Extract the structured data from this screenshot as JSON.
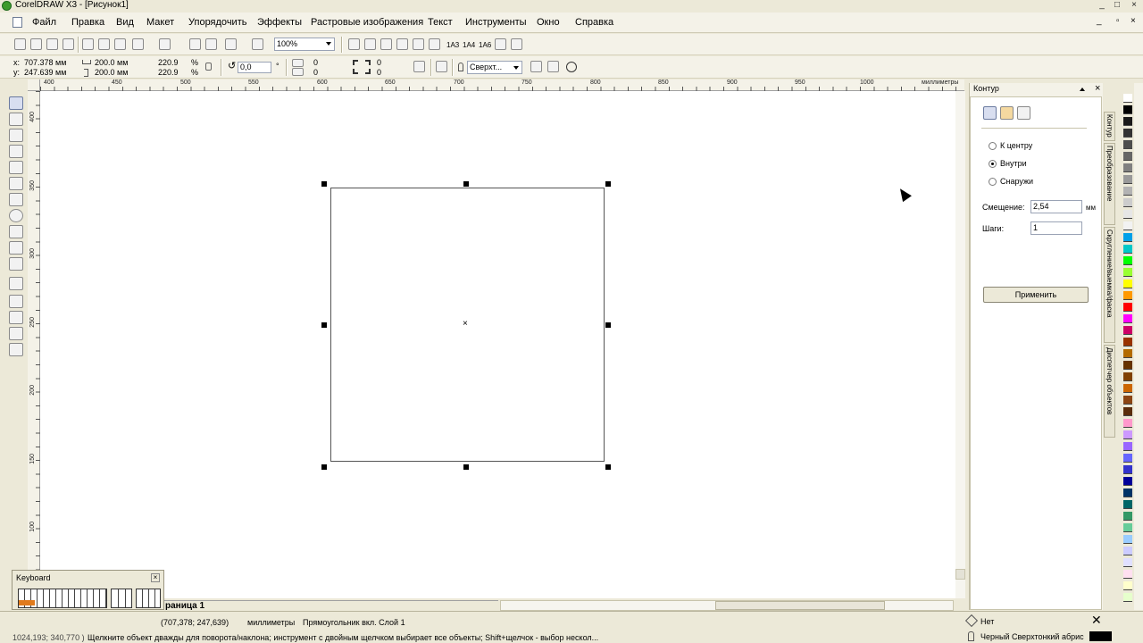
{
  "window": {
    "title": "CorelDRAW X3 - [Рисунок1]",
    "controls": [
      "_",
      "□",
      "×"
    ],
    "doc_controls": [
      "_",
      "▫",
      "×"
    ]
  },
  "menu": [
    "Файл",
    "Правка",
    "Вид",
    "Макет",
    "Упорядочить",
    "Эффекты",
    "Растровые изображения",
    "Текст",
    "Инструменты",
    "Окно",
    "Справка"
  ],
  "toolbar": {
    "zoom": "100%",
    "text_icons": [
      "1A3",
      "1A4",
      "1A6"
    ]
  },
  "propbar": {
    "x_label": "x:",
    "x_value": "707.378 мм",
    "y_label": "y:",
    "y_value": "247.639 мм",
    "width": "200.0 мм",
    "height": "200.0 мм",
    "scale_w": "220.9",
    "scale_h": "220.9",
    "pct": "%",
    "angle": "0,0",
    "deg": "°",
    "corner_tl": "0",
    "corner_bl": "0",
    "corner_tr": "0",
    "corner_br": "0",
    "outline_width": "Сверхт..."
  },
  "ruler_top": {
    "ticks": [
      "400",
      "450",
      "500",
      "550",
      "600",
      "650",
      "700",
      "750",
      "800",
      "850",
      "900",
      "950",
      "1000"
    ],
    "units": "миллиметры"
  },
  "ruler_left": {
    "ticks": [
      "400",
      "350",
      "300",
      "250",
      "200",
      "150",
      "100"
    ]
  },
  "docker": {
    "title": "Контур",
    "options": [
      "К центру",
      "Внутри",
      "Снаружи"
    ],
    "selected_option": "Внутри",
    "offset_label": "Смещение:",
    "offset_value": "2,54",
    "offset_unit": "мм",
    "steps_label": "Шаги:",
    "steps_value": "1",
    "apply_label": "Применить"
  },
  "vertical_tabs": [
    "Контур",
    "Преобразование",
    "Скругление/выемка/фаска",
    "Диспетчер объектов"
  ],
  "page_tab": "раница 1",
  "keyboard_widget": {
    "title": "Keyboard"
  },
  "status": {
    "coords": "(707,378; 247,639)",
    "units": "миллиметры",
    "object_info": "Прямоугольник вкл. Слой 1",
    "hint_prefix": "1024,193; 340,770 )",
    "hint": "Щелкните объект дважды для поворота/наклона; инструмент с двойным щелчком выбирает все объекты; Shift+щелчок - выбор нескол...",
    "fill_label": "Нет",
    "outline_label": "Черный  Сверхтонкий абрис"
  },
  "colors": {
    "palette": [
      "#ffffff",
      "#000000",
      "#1a1a1a",
      "#333333",
      "#4d4d4d",
      "#666666",
      "#808080",
      "#999999",
      "#b3b3b3",
      "#cccccc",
      "#e6e6e6",
      "#f2f2f2",
      "#00a0e8",
      "#00c8c8",
      "#00ff00",
      "#99ff33",
      "#ffff00",
      "#ff9900",
      "#ff0000",
      "#ff00ff",
      "#cc0066",
      "#993300",
      "#b36b00",
      "#663300",
      "#804000",
      "#cc6600",
      "#8b4513",
      "#5a2d0c",
      "#ff99cc",
      "#cc99ff",
      "#9966ff",
      "#6666ff",
      "#3333cc",
      "#000099",
      "#003366",
      "#006666",
      "#339966",
      "#66cc99",
      "#99ccff",
      "#ccccff",
      "#e0e0ff",
      "#ffe0f0",
      "#ffffcc",
      "#e6ffcc"
    ]
  }
}
